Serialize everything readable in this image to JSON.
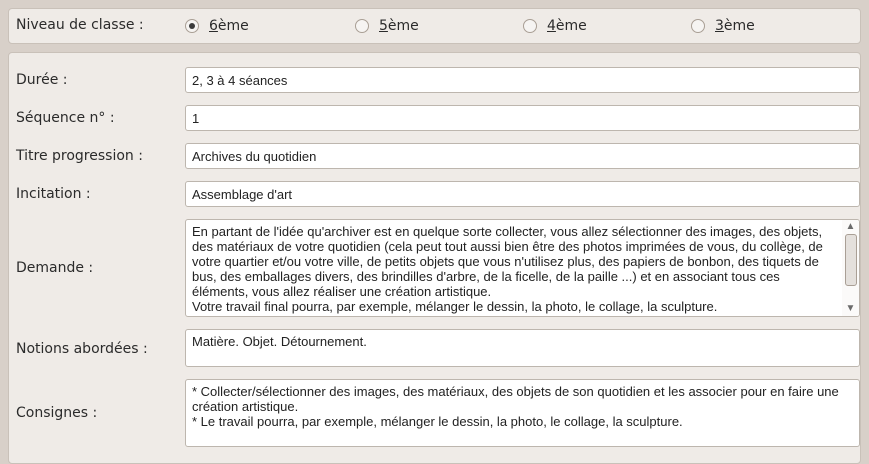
{
  "level": {
    "label": "Niveau de classe :",
    "options": [
      {
        "mnemonic": "6",
        "rest": "ème",
        "checked": true
      },
      {
        "mnemonic": "5",
        "rest": "ème",
        "checked": false
      },
      {
        "mnemonic": "4",
        "rest": "ème",
        "checked": false
      },
      {
        "mnemonic": "3",
        "rest": "ème",
        "checked": false
      }
    ]
  },
  "form": {
    "duree": {
      "label": "Durée :",
      "value": "2, 3 à 4 séances"
    },
    "sequence": {
      "label": "Séquence n° :",
      "value": "1"
    },
    "titre": {
      "label": "Titre progression :",
      "value": "Archives du quotidien"
    },
    "incitation": {
      "label": "Incitation :",
      "value": "Assemblage d'art"
    },
    "demande": {
      "label": "Demande :",
      "lines": [
        "En partant de l'idée qu'archiver est en quelque sorte collecter, vous allez sélectionner des images, des objets,",
        "des matériaux de votre quotidien (cela peut tout aussi bien être des photos imprimées de vous, du collège, de",
        "votre quartier et/ou votre ville, de petits objets que vous n'utilisez plus, des papiers de bonbon, des tiquets de",
        "bus, des emballages divers, des brindilles d'arbre, de la ficelle, de la paille ...) et en associant tous ces",
        "éléments, vous allez réaliser une création artistique.",
        "Votre travail final pourra, par exemple, mélanger le dessin, la photo, le collage, la sculpture."
      ]
    },
    "notions": {
      "label": "Notions abordées :",
      "lines": [
        "Matière. Objet. Détournement."
      ]
    },
    "consignes": {
      "label": "Consignes :",
      "lines": [
        "* Collecter/sélectionner des images, des matériaux, des objets de son quotidien et les associer pour en faire une",
        "création artistique.",
        "* Le travail pourra, par exemple, mélanger le dessin, la photo, le collage, la sculpture."
      ]
    }
  }
}
